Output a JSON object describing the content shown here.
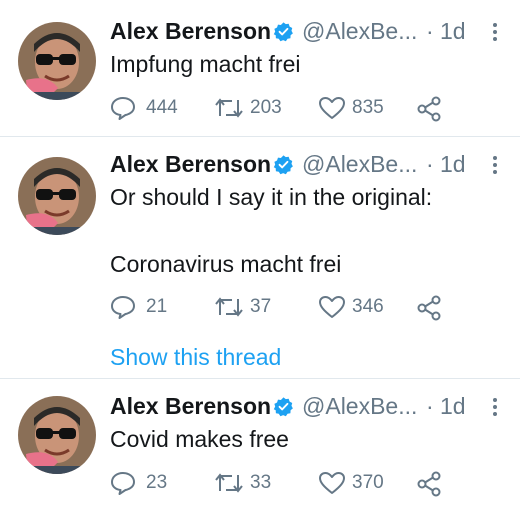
{
  "tweets": [
    {
      "author": "Alex Berenson",
      "handle": "@AlexBe...",
      "separator": "·",
      "time": "1d",
      "text_lines": [
        "Impfung macht frei"
      ],
      "replies": "444",
      "retweets": "203",
      "likes": "835"
    },
    {
      "author": "Alex Berenson",
      "handle": "@AlexBe...",
      "separator": "·",
      "time": "1d",
      "text_lines": [
        "Or should I say it in the original:",
        "Coronavirus macht frei"
      ],
      "replies": "21",
      "retweets": "37",
      "likes": "346",
      "thread_link": "Show this thread"
    },
    {
      "author": "Alex Berenson",
      "handle": "@AlexBe...",
      "separator": "·",
      "time": "1d",
      "text_lines": [
        "Covid makes free"
      ],
      "replies": "23",
      "retweets": "33",
      "likes": "370"
    }
  ],
  "colors": {
    "text": "#14171a",
    "secondary": "#657786",
    "accent": "#1da1f2",
    "divider": "#e1e8ed"
  },
  "icons": [
    "verified-badge-icon",
    "more-options-icon",
    "reply-icon",
    "retweet-icon",
    "like-icon",
    "share-icon"
  ]
}
